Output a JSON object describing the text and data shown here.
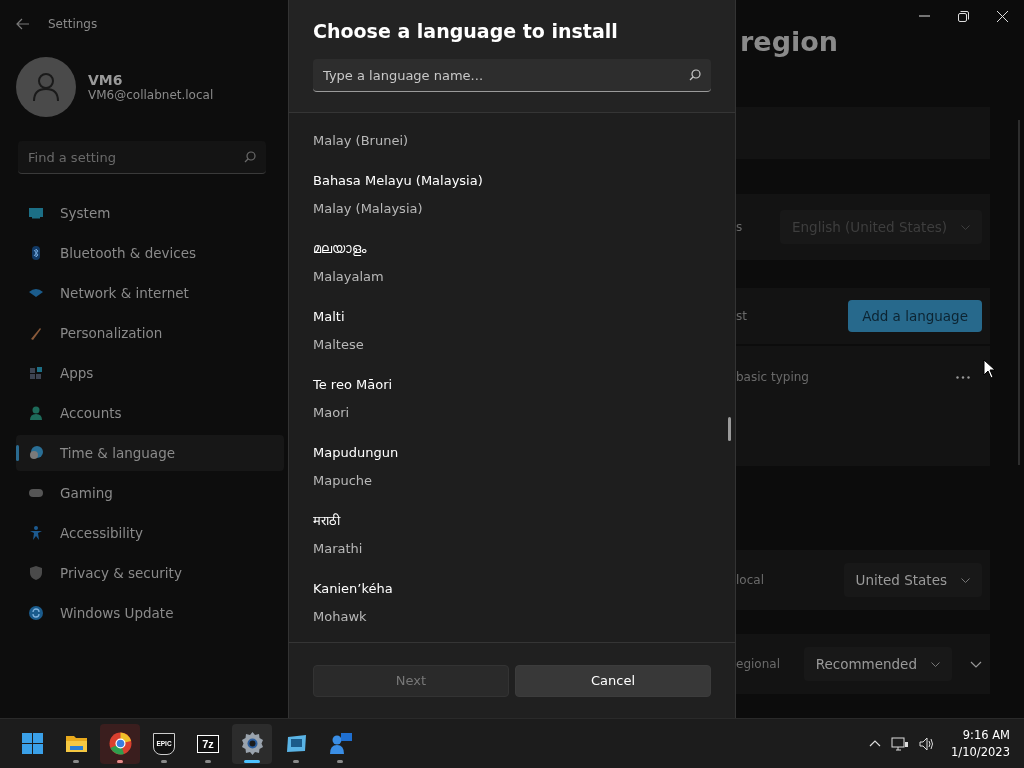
{
  "window": {
    "title": "Settings"
  },
  "user": {
    "name": "VM6",
    "email": "VM6@collabnet.local"
  },
  "sidebar": {
    "search": {
      "placeholder": "Find a setting"
    },
    "items": [
      {
        "label": "System",
        "selected": false
      },
      {
        "label": "Bluetooth & devices",
        "selected": false
      },
      {
        "label": "Network & internet",
        "selected": false
      },
      {
        "label": "Personalization",
        "selected": false
      },
      {
        "label": "Apps",
        "selected": false
      },
      {
        "label": "Accounts",
        "selected": false
      },
      {
        "label": "Time & language",
        "selected": true
      },
      {
        "label": "Gaming",
        "selected": false
      },
      {
        "label": "Accessibility",
        "selected": false
      },
      {
        "label": "Privacy & security",
        "selected": false
      },
      {
        "label": "Windows Update",
        "selected": false
      }
    ]
  },
  "page": {
    "title": "region",
    "rows": [
      {
        "label": "s",
        "control": {
          "kind": "dropdown",
          "value": "English (United States)",
          "disabled": true
        }
      },
      {
        "label": "st",
        "control": {
          "kind": "button",
          "text": "Add a language"
        }
      },
      {
        "label": "basic typing",
        "control": {
          "kind": "more"
        }
      },
      {
        "label": "local",
        "control": {
          "kind": "dropdown",
          "value": "United States",
          "disabled": false
        }
      },
      {
        "label": "egional",
        "control": {
          "kind": "dropdown",
          "value": "Recommended",
          "disabled": false,
          "expandable": true
        }
      }
    ]
  },
  "dialog": {
    "title": "Choose a language to install",
    "search": {
      "placeholder": "Type a language name..."
    },
    "languages": [
      {
        "english": "Malay (Brunei)"
      },
      {
        "native": "Bahasa Melayu (Malaysia)",
        "english": "Malay (Malaysia)"
      },
      {
        "native": "മലയാളം",
        "english": "Malayalam"
      },
      {
        "native": "Malti",
        "english": "Maltese"
      },
      {
        "native": "Te reo Māori",
        "english": "Maori"
      },
      {
        "native": "Mapudungun",
        "english": "Mapuche"
      },
      {
        "native": "मराठी",
        "english": "Marathi"
      },
      {
        "native": "Kanien’kéha",
        "english": "Mohawk"
      }
    ],
    "buttons": [
      {
        "label": "Next",
        "disabled": true
      },
      {
        "label": "Cancel",
        "disabled": false
      }
    ]
  },
  "taskbar": {
    "apps": [
      {
        "running": false,
        "active": false,
        "attention": false
      },
      {
        "running": true,
        "active": false,
        "attention": false
      },
      {
        "running": true,
        "active": false,
        "attention": true
      },
      {
        "running": true,
        "active": false,
        "attention": false,
        "glyph": "EPIC"
      },
      {
        "running": true,
        "active": false,
        "attention": false,
        "glyph": "7z"
      },
      {
        "running": true,
        "active": true,
        "attention": false
      },
      {
        "running": true,
        "active": false,
        "attention": false
      },
      {
        "running": true,
        "active": false,
        "attention": false
      }
    ],
    "clock": {
      "time": "9:16 AM",
      "date": "1/10/2023"
    }
  }
}
